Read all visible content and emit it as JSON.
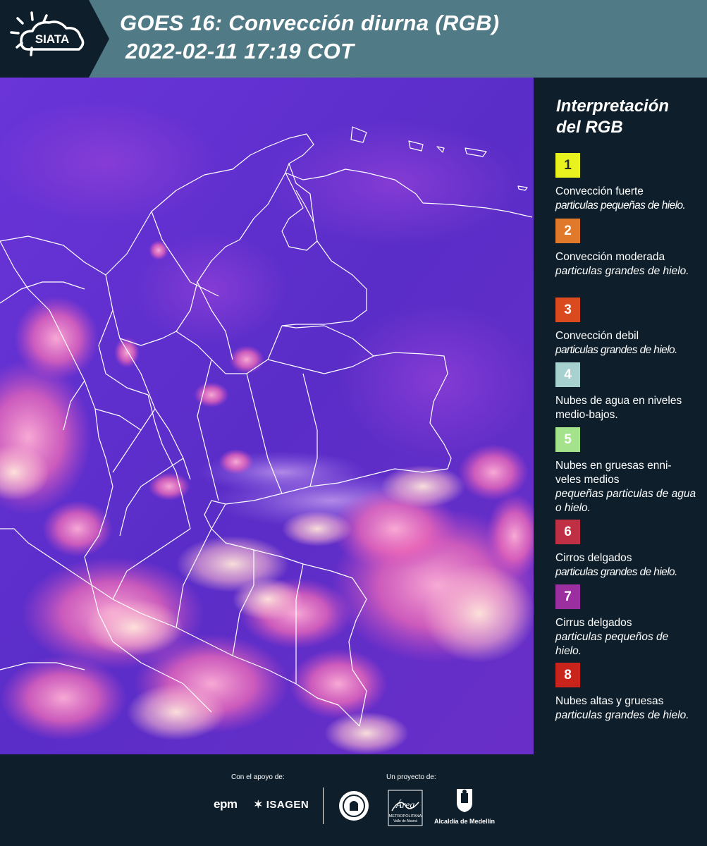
{
  "header": {
    "logo_text": "SIATA",
    "title_line1": "GOES 16: Convección diurna (RGB)",
    "title_line2": "2022-02-11 17:19 COT"
  },
  "legend": {
    "title": "Interpretación del RGB",
    "items": [
      {
        "number": "1",
        "color": "#e8f21e",
        "label": "Convección fuerte",
        "detail": "particulas pequeñas de hielo."
      },
      {
        "number": "2",
        "color": "#e07a2a",
        "label": "Convección moderada",
        "detail": "particulas grandes de hielo."
      },
      {
        "number": "3",
        "color": "#d94a1e",
        "label": "Convección debil",
        "detail": "particulas grandes de hielo."
      },
      {
        "number": "4",
        "color": "#a6d1cf",
        "label": "Nubes de agua en niveles medio-bajos.",
        "detail": ""
      },
      {
        "number": "5",
        "color": "#a4e38c",
        "label": "Nubes en gruesas enni- veles medios",
        "detail": "pequeñas particulas de agua o hielo."
      },
      {
        "number": "6",
        "color": "#c03045",
        "label": "Cirros delgados",
        "detail": "particulas grandes de hielo."
      },
      {
        "number": "7",
        "color": "#9b2fa0",
        "label": "Cirrus delgados",
        "detail": "particulas pequeños de hielo."
      },
      {
        "number": "8",
        "color": "#c9241c",
        "label": "Nubes altas y gruesas",
        "detail": "particulas grandes de hielo."
      }
    ]
  },
  "footer": {
    "support_label": "Con el apoyo de:",
    "project_label": "Un proyecto de:",
    "sponsor1": "epm",
    "sponsor2": "ISAGEN",
    "area_text1": "Área",
    "area_text2": "METROPOLITANA",
    "area_text3": "Valle de Aburrá",
    "alcaldia": "Alcaldía de Medellín"
  },
  "colors": {
    "header_bg": "#4f7a86",
    "panel_bg": "#0e1f2b",
    "map_base": "#5a2fd0",
    "cloud_pink": "#f07ab8",
    "cloud_light": "#f6d7d6"
  },
  "icons": {
    "logo": "sun-cloud-icon",
    "seal": "municipal-seal-icon",
    "area": "area-metropolitana-logo",
    "alcaldia": "coat-of-arms-icon"
  }
}
